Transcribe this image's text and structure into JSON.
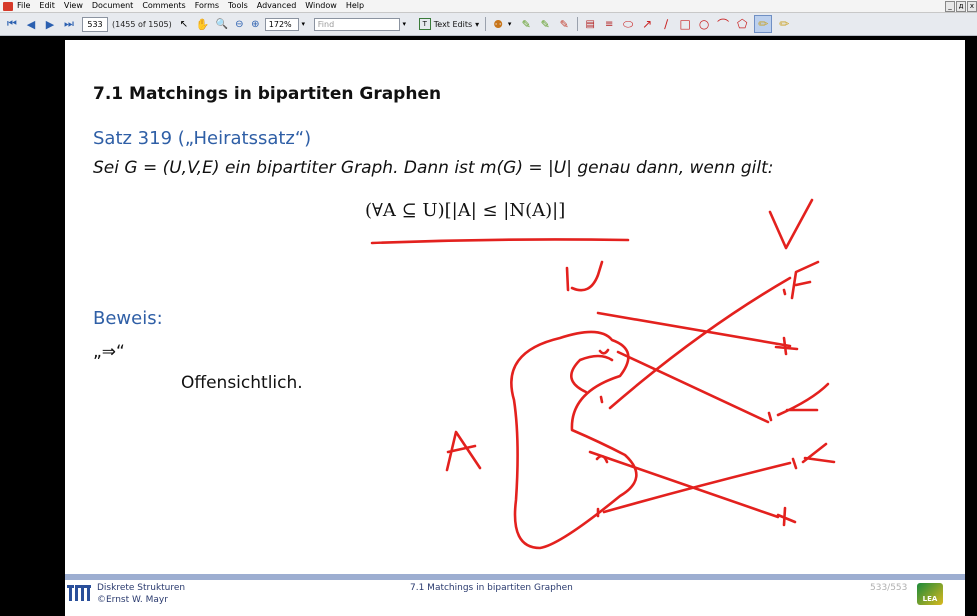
{
  "menubar": {
    "items": [
      "File",
      "Edit",
      "View",
      "Document",
      "Comments",
      "Forms",
      "Tools",
      "Advanced",
      "Window",
      "Help"
    ],
    "window_buttons": [
      "_",
      "д",
      "x"
    ]
  },
  "toolbar": {
    "page_value": "533",
    "page_count": "(1455 of 1505)",
    "zoom_value": "172%",
    "find_placeholder": "Find",
    "text_edits_label": "Text Edits"
  },
  "slide": {
    "section_title": "7.1 Matchings in bipartiten Graphen",
    "satz_label": "Satz 319 („Heiratssatz“)",
    "theorem_text": "Sei G = (U,V,E) ein bipartiter Graph. Dann ist m(G) = |U| genau dann, wenn gilt:",
    "formula": "(∀A ⊆ U)[|A| ≤ |N(A)|]",
    "beweis_label": "Beweis:",
    "direction_label": "„⇒“",
    "proof_text": "Offensichtlich."
  },
  "footer": {
    "course": "Diskrete Strukturen",
    "author": "©Ernst W. Mayr",
    "section": "7.1 Matchings in bipartiten Graphen",
    "page": "533/553",
    "lea_logo": "LEA"
  },
  "ink_annotations": {
    "letters": [
      "V",
      "U",
      "A"
    ],
    "color": "#e3211e"
  },
  "colors": {
    "slide_heading_blue": "#2f5fa6",
    "footer_bar": "#9daed1",
    "annotation_red": "#e3211e"
  }
}
